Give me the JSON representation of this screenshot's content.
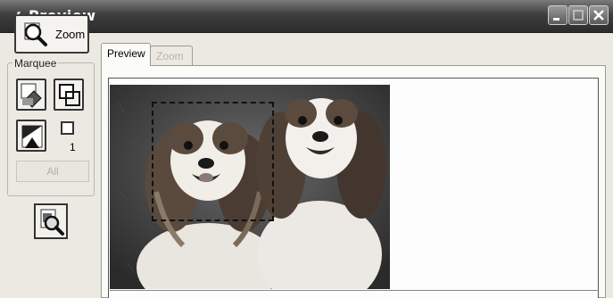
{
  "window": {
    "title": "Preview"
  },
  "toolbar": {
    "zoom_label": "Zoom"
  },
  "marquee": {
    "group_label": "Marquee",
    "count": "1",
    "all_label": "All"
  },
  "tabs": [
    {
      "label": "Preview",
      "active": true
    },
    {
      "label": "Zoom",
      "active": false
    }
  ],
  "icons": {
    "app": "scanner-icon",
    "minimize": "minimize-icon",
    "maximize": "maximize-icon",
    "close": "close-icon",
    "zoom": "magnifier-icon",
    "auto_locate": "auto-locate-icon",
    "duplicate_marquee": "duplicate-marquee-icon",
    "auto_exposure": "auto-exposure-icon",
    "preview_zoom": "preview-zoom-icon"
  },
  "colors": {
    "titlebar": "#3e3e3e",
    "window_bg": "#ece9e2",
    "preview_bg": "#fbfbf8",
    "disabled_text": "#b7b4ac"
  }
}
